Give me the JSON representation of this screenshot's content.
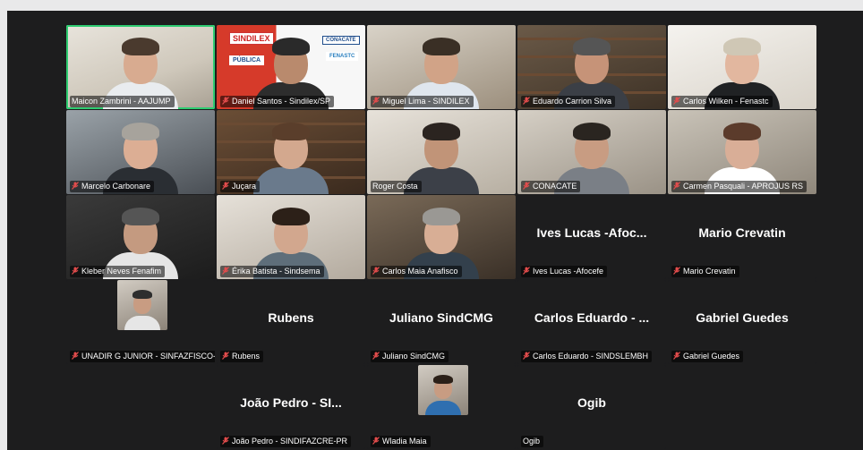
{
  "meeting": {
    "colors": {
      "background": "#1d1d1e",
      "active_speaker": "#2ecc71",
      "muted_icon": "#e24c4c",
      "name_text": "#ffffff"
    },
    "participants": [
      {
        "name": "Maicon Zambrini - AAJUMP",
        "muted": false,
        "video": true,
        "active": true
      },
      {
        "name": "Daniel Santos - Sindilex/SP",
        "muted": true,
        "video": true
      },
      {
        "name": "Miguel Lima - SINDILEX",
        "muted": true,
        "video": true
      },
      {
        "name": "Eduardo Carrion Silva",
        "muted": true,
        "video": true
      },
      {
        "name": "Carlos Wilken - Fenastc",
        "muted": true,
        "video": true
      },
      {
        "name": "Marcelo Carbonare",
        "muted": true,
        "video": true
      },
      {
        "name": "Juçara",
        "muted": true,
        "video": true
      },
      {
        "name": "Roger Costa",
        "muted": false,
        "video": true
      },
      {
        "name": "CONACATE",
        "muted": true,
        "video": true
      },
      {
        "name": "Carmen Pasquali - APROJUS RS",
        "muted": true,
        "video": true
      },
      {
        "name": "Kleber Neves Fenafim",
        "muted": true,
        "video": true
      },
      {
        "name": "Érika Batista - Sindsema",
        "muted": true,
        "video": true
      },
      {
        "name": "Carlos Maia Anafisco",
        "muted": true,
        "video": true
      },
      {
        "name": "Ives Lucas -Afocefe",
        "muted": true,
        "video": false,
        "display": "Ives Lucas -Afoc..."
      },
      {
        "name": "Mario Crevatin",
        "muted": true,
        "video": false,
        "display": "Mario Crevatin"
      },
      {
        "name": "UNADIR G JUNIOR - SINFAZFISCO-...",
        "muted": true,
        "video": false,
        "avatar": true
      },
      {
        "name": "Rubens",
        "muted": true,
        "video": false,
        "display": "Rubens"
      },
      {
        "name": "Juliano SindCMG",
        "muted": true,
        "video": false,
        "display": "Juliano SindCMG"
      },
      {
        "name": "Carlos Eduardo - SINDSLEMBH",
        "muted": true,
        "video": false,
        "display": "Carlos Eduardo - ..."
      },
      {
        "name": "Gabriel Guedes",
        "muted": true,
        "video": false,
        "display": "Gabriel Guedes"
      },
      {
        "name": "João Pedro - SINDIFAZCRE-PR",
        "muted": true,
        "video": false,
        "display": "João Pedro - SI..."
      },
      {
        "name": "Wladia Maia",
        "muted": true,
        "video": false,
        "avatar": true
      },
      {
        "name": "Ogib",
        "muted": false,
        "video": false,
        "display": "Ogib"
      }
    ],
    "backdrop": {
      "sindilex": "SINDILEX",
      "conacate": "CONACATE",
      "fenastc": "FENASTC",
      "publica": "PÚBLICA"
    }
  }
}
